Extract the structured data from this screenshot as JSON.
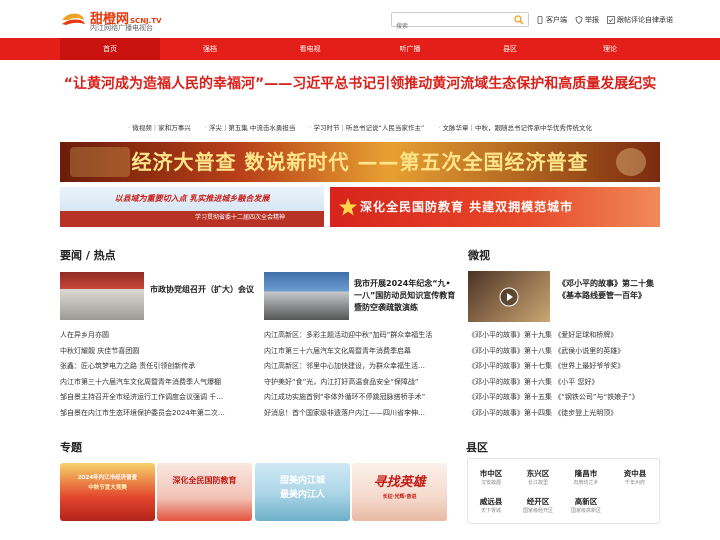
{
  "header": {
    "logo_title": "甜橙网",
    "logo_domain": "SCNJ.TV",
    "logo_sub": "内江网络广播电视台",
    "search_placeholder": "搜索",
    "links": [
      {
        "label": "客户端",
        "icon": "phone-icon"
      },
      {
        "label": "举报",
        "icon": "shield-icon"
      },
      {
        "label": "跟帖评论自律承诺",
        "icon": "check-icon"
      }
    ]
  },
  "nav": {
    "items": [
      "首页",
      "强档",
      "看电视",
      "听广播",
      "县区",
      "理论"
    ],
    "active_index": 0
  },
  "headline": {
    "title": "“让黄河成为造福人民的幸福河”——习近平总书记引领推动黄河流域生态保护和高质量发展纪实",
    "sublinks": [
      "微视频｜家和万事兴",
      "浮尖｜第五集 中流击水勇担当",
      "学习时节｜听总书记说“人民当家作主”",
      "文脉华章｜中秋，跟随总书记传承中华优秀传统文化"
    ]
  },
  "banners": {
    "main": "经济大普查 数说新时代 ——第五次全国经济普查",
    "left_title": "以县域为重要切入点 乳实推进城乡融合发展",
    "left_sub": "学习贯彻省委十二届四次全会精神",
    "right": "深化全民国防教育  共建双拥模范城市"
  },
  "sections": {
    "news_title": "要闻 / 热点",
    "video_title": "微视",
    "topics_title": "专题",
    "districts_title": "县区"
  },
  "news": {
    "feature1": "市政协党组召开（扩大）会议",
    "feature2": "我市开展2024年纪念“九•一八”国防动员知识宣传教育暨防空袭疏散演练",
    "col1": [
      "人在异乡月亦圆",
      "中秋灯耀靓 庆佳节喜团圆",
      "张鑫：匠心筑梦电力之路 责任引领创新传承",
      "内江市第三十六届汽车文化周暨青年消费季人气爆棚",
      "邹自景主持召开全市经济运行工作调度会议强调 千…",
      "邹自景在内江市生态环境保护委员会2024年第二次…"
    ],
    "col2": [
      "内江高新区：多彩主题活动迎中秋“加码”群众幸福生活",
      "内江市第三十六届汽车文化周暨青年消费季启幕",
      "内江高新区：邻里中心加快建设，为群众幸福生活…",
      "守护美好“食”光，内江打好高温食品安全“保障战”",
      "内江成功实施首例“非体外循环不停跳冠脉搭桥手术”",
      "好消息！首个国家级非遗落户内江——四川省李伸…"
    ]
  },
  "video": {
    "feature": "《邓小平的故事》第二十集 《基本路线要管一百年》",
    "list": [
      "《邓小平的故事》第十九集 《爱好足球和桥牌》",
      "《邓小平的故事》第十八集 《武侯小说里的英雄》",
      "《邓小平的故事》第十七集 《世界上最好爷爷奖》",
      "《邓小平的故事》第十六集 《小平 您好》",
      "《邓小平的故事》第十五集 《“钢铁公司”与“铁娘子”》",
      "《邓小平的故事》第十四集 《徒步登上光明顶》"
    ]
  },
  "topics": [
    {
      "line1": "2024年内江市经济普查",
      "line2": "中秋节宣大竞赛"
    },
    {
      "line1": "深化全民国防教育",
      "line2": ""
    },
    {
      "line1": "甜美内江城",
      "line2": "最美内江人"
    },
    {
      "line1": "寻找英雄",
      "line2": "长征·光辉·奋进"
    }
  ],
  "districts": [
    {
      "name": "市中区",
      "slogan": "汉安故郡"
    },
    {
      "name": "东兴区",
      "slogan": "长江故里"
    },
    {
      "name": "隆昌市",
      "slogan": "石牌坊之乡"
    },
    {
      "name": "资中县",
      "slogan": "千年州府"
    },
    {
      "name": "威远县",
      "slogan": "天下胃城"
    },
    {
      "name": "经开区",
      "slogan": "国家级经开区"
    },
    {
      "name": "高新区",
      "slogan": "国家级高新区"
    }
  ],
  "colors": {
    "brand_red": "#e41f19",
    "active_nav": "#c8130e",
    "headline_red": "#d8211b",
    "search_accent": "#f0a020"
  }
}
